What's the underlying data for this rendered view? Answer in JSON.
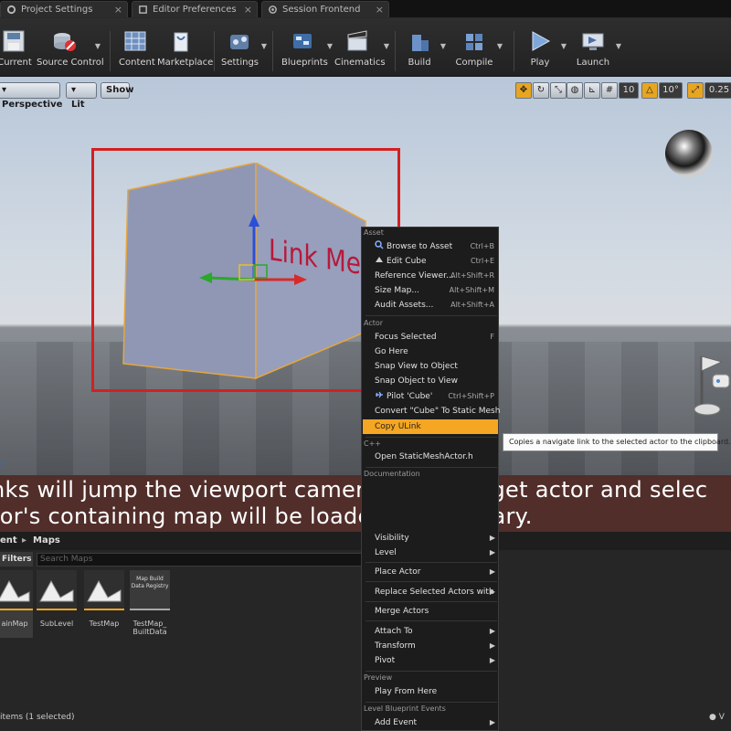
{
  "tabs": [
    {
      "label": "Project Settings"
    },
    {
      "label": "Editor Preferences"
    },
    {
      "label": "Session Frontend"
    }
  ],
  "toolbar": {
    "buttons": [
      {
        "label": "Current",
        "icon": "save-icon"
      },
      {
        "label": "Source Control",
        "icon": "source-control-icon"
      },
      {
        "label": "Content",
        "icon": "content-icon"
      },
      {
        "label": "Marketplace",
        "icon": "marketplace-icon"
      },
      {
        "label": "Settings",
        "icon": "settings-icon"
      },
      {
        "label": "Blueprints",
        "icon": "blueprints-icon"
      },
      {
        "label": "Cinematics",
        "icon": "cinematics-icon"
      },
      {
        "label": "Build",
        "icon": "build-icon"
      },
      {
        "label": "Compile",
        "icon": "compile-icon"
      },
      {
        "label": "Play",
        "icon": "play-icon"
      },
      {
        "label": "Launch",
        "icon": "launch-icon"
      }
    ]
  },
  "viewport": {
    "perspective_label": "Perspective",
    "lit_label": "Lit",
    "show_label": "Show",
    "grid_snap": "10",
    "rotation_snap": "10°",
    "scale_snap": "0.25",
    "cube_text": "Link Me!",
    "axis_label": "z"
  },
  "context_menu": {
    "sections": {
      "asset": "Asset",
      "actor": "Actor",
      "cpp": "C++",
      "documentation": "Documentation",
      "preview": "Preview",
      "level_bp": "Level Blueprint Events"
    },
    "asset_items": [
      {
        "label": "Browse to Asset",
        "shortcut": "Ctrl+B"
      },
      {
        "label": "Edit Cube",
        "shortcut": "Ctrl+E"
      },
      {
        "label": "Reference Viewer...",
        "shortcut": "Alt+Shift+R"
      },
      {
        "label": "Size Map...",
        "shortcut": "Alt+Shift+M"
      },
      {
        "label": "Audit Assets...",
        "shortcut": "Alt+Shift+A"
      }
    ],
    "actor_items": [
      {
        "label": "Focus Selected",
        "shortcut": "F"
      },
      {
        "label": "Go Here",
        "shortcut": ""
      },
      {
        "label": "Snap View to Object",
        "shortcut": ""
      },
      {
        "label": "Snap Object to View",
        "shortcut": ""
      },
      {
        "label": "Pilot 'Cube'",
        "shortcut": "Ctrl+Shift+P"
      },
      {
        "label": "Convert \"Cube\" To Static Mesh",
        "shortcut": ""
      },
      {
        "label": "Copy ULink",
        "shortcut": ""
      }
    ],
    "cpp_items": [
      {
        "label": "Open StaticMeshActor.h"
      }
    ],
    "lower_items": [
      {
        "label": "Visibility"
      },
      {
        "label": "Level"
      },
      {
        "label": "Place Actor"
      },
      {
        "label": "Replace Selected Actors with"
      },
      {
        "label": "Merge Actors"
      },
      {
        "label": "Attach To"
      },
      {
        "label": "Transform"
      },
      {
        "label": "Pivot"
      }
    ],
    "preview_items": [
      {
        "label": "Play From Here"
      }
    ],
    "level_bp_items": [
      {
        "label": "Add Event"
      }
    ]
  },
  "tooltip": "Copies a navigate link to the selected actor to the clipboard.",
  "caption": {
    "line1": "nks will jump the viewport camera to the target actor and selec",
    "line2": "tor's containing map will be loaded if necessary."
  },
  "content_browser": {
    "breadcrumb_root": "ent",
    "breadcrumb_folder": "Maps",
    "filters_label": "Filters",
    "search_placeholder": "Search Maps",
    "assets": [
      {
        "name": "ainMap"
      },
      {
        "name": "SubLevel"
      },
      {
        "name": "TestMap"
      },
      {
        "name": "TestMap_ BuiltData",
        "thumb_text": "Map Build Data Registry"
      }
    ],
    "status": "items (1 selected)"
  },
  "colors": {
    "accent": "#f5a623",
    "selection_box": "#d42020",
    "caption_bg": "#56302c"
  }
}
